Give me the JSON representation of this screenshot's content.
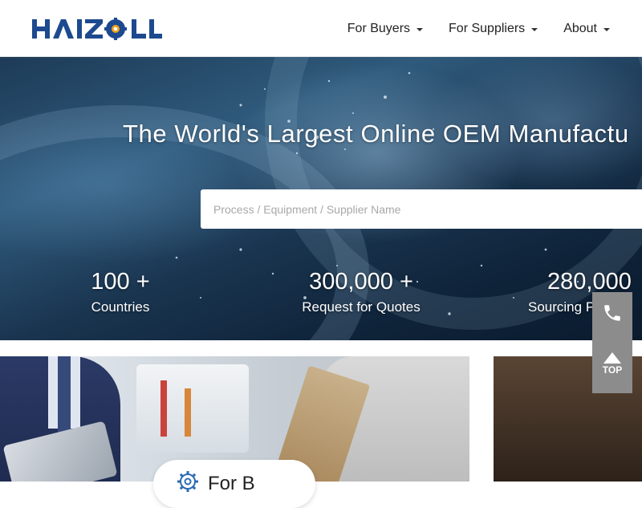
{
  "header": {
    "logo_text": "HAIZOL",
    "nav": [
      {
        "label": "For Buyers"
      },
      {
        "label": "For Suppliers"
      },
      {
        "label": "About"
      }
    ]
  },
  "hero": {
    "title": "The World's Largest Online OEM Manufactu",
    "search_placeholder": "Process / Equipment / Supplier Name",
    "stats": [
      {
        "value": "100 +",
        "label": "Countries"
      },
      {
        "value": "300,000 +",
        "label": "Request for Quotes"
      },
      {
        "value": "280,000",
        "label": "Sourcing P"
      }
    ]
  },
  "cards": {
    "buyers_pill_label": "For B",
    "pill_icon": "gear-icon"
  },
  "side": {
    "phone_icon": "phone-icon",
    "top_label": "TOP"
  },
  "colors": {
    "brand_blue": "#1d4a8f",
    "side_button": "#8c8c8c"
  }
}
